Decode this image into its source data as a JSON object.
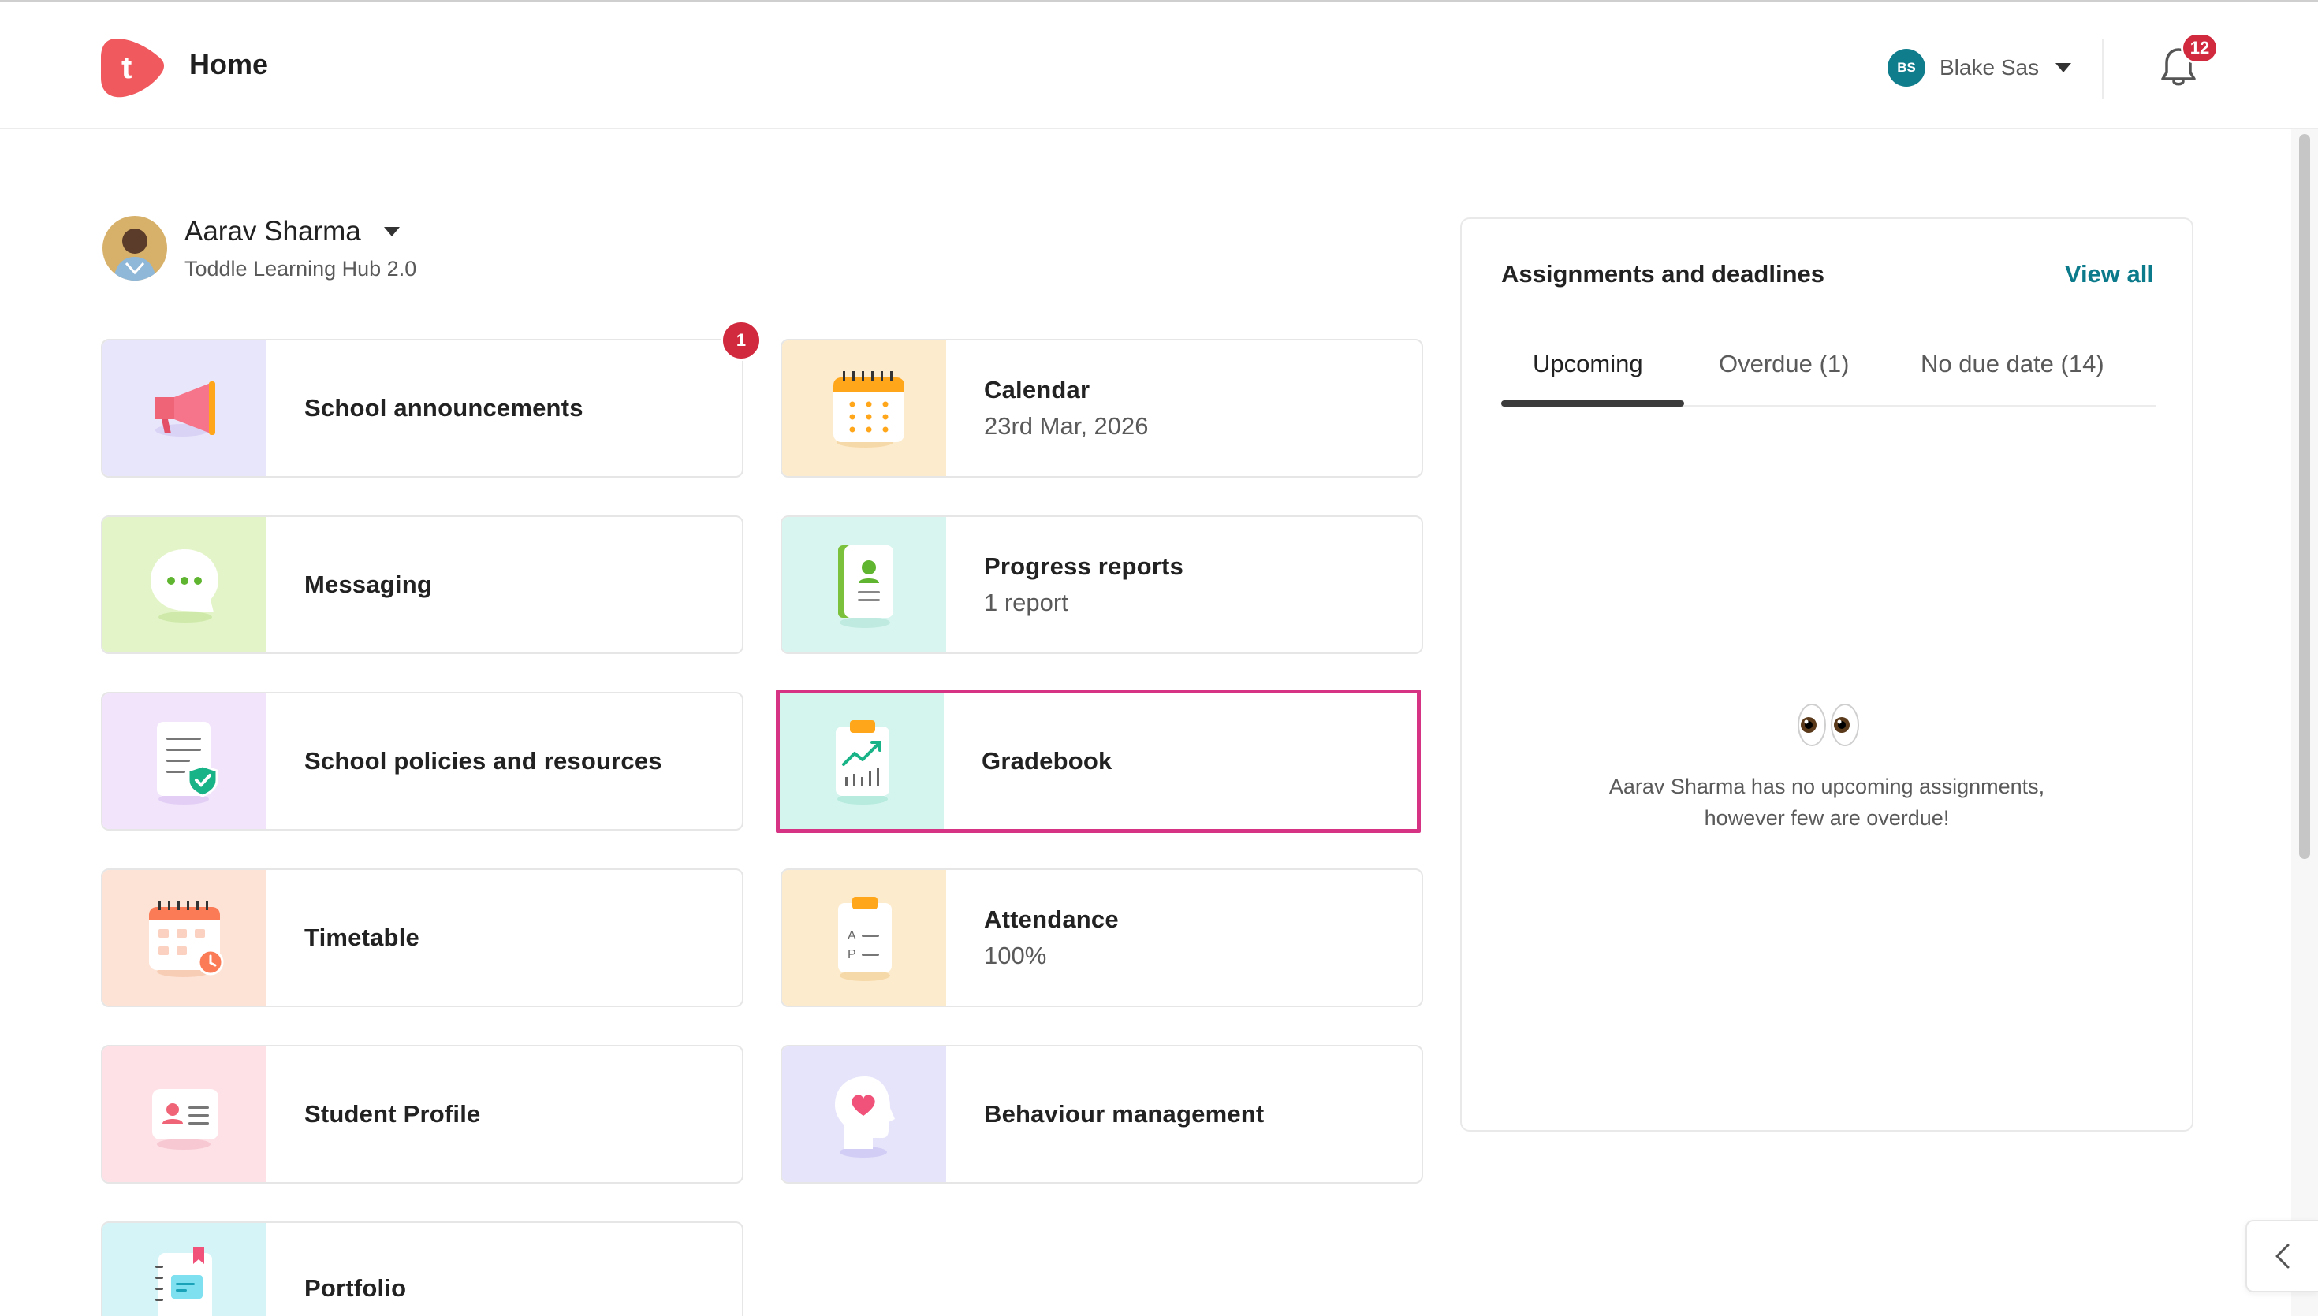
{
  "header": {
    "title": "Home",
    "user": {
      "initials": "BS",
      "name": "Blake Sas"
    },
    "notifications_count": "12"
  },
  "student": {
    "name": "Aarav Sharma",
    "subtitle": "Toddle Learning Hub 2.0"
  },
  "modules": [
    {
      "title": "School announcements",
      "subtitle": "",
      "badge": "1"
    },
    {
      "title": "Calendar",
      "subtitle": "23rd Mar, 2026"
    },
    {
      "title": "Messaging",
      "subtitle": ""
    },
    {
      "title": "Progress reports",
      "subtitle": "1 report"
    },
    {
      "title": "School policies and resources",
      "subtitle": ""
    },
    {
      "title": "Gradebook",
      "subtitle": ""
    },
    {
      "title": "Timetable",
      "subtitle": ""
    },
    {
      "title": "Attendance",
      "subtitle": "100%"
    },
    {
      "title": "Student Profile",
      "subtitle": ""
    },
    {
      "title": "Behaviour management",
      "subtitle": ""
    },
    {
      "title": "Portfolio",
      "subtitle": ""
    }
  ],
  "assignments": {
    "title": "Assignments and deadlines",
    "view_all": "View all",
    "tabs": [
      {
        "label": "Upcoming"
      },
      {
        "label": "Overdue (1)"
      },
      {
        "label": "No due date (14)"
      }
    ],
    "empty_line1": "Aarav Sharma has no upcoming assignments,",
    "empty_line2": "however few are overdue!"
  },
  "colors": {
    "accent_teal": "#0b7a8a",
    "badge_red": "#d1293d",
    "selection_pink": "#d63384",
    "brand_coral": "#f05a5f"
  }
}
